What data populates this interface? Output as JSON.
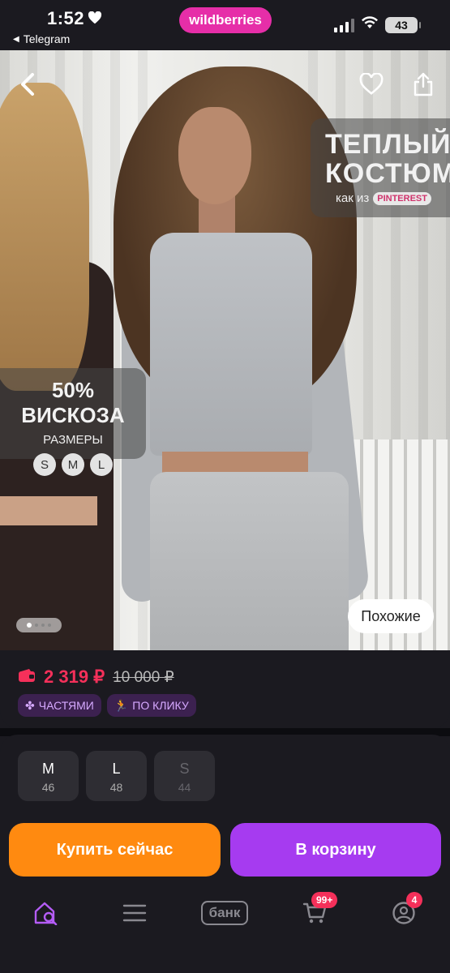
{
  "status_bar": {
    "time": "1:52",
    "back_app": "Telegram",
    "app_pill": "wildberries",
    "battery": "43"
  },
  "photo": {
    "badge_right": {
      "line1": "ТЕПЛЫЙ",
      "line2": "КОСТЮМ",
      "caption": "как из",
      "tag": "PINTEREST"
    },
    "badge_left": {
      "headline": "50% ВИСКОЗА",
      "sub": "РАЗМЕРЫ",
      "sizes": [
        "S",
        "M",
        "L"
      ]
    },
    "carousel": {
      "count": 4,
      "active_index": 0
    },
    "similar_button": "Похожие"
  },
  "price": {
    "current": "2 319 ₽",
    "old": "10 000 ₽",
    "chips": [
      "ЧАСТЯМИ",
      "ПО КЛИКУ"
    ]
  },
  "sizes": [
    {
      "size": "M",
      "ru": "46",
      "available": true
    },
    {
      "size": "L",
      "ru": "48",
      "available": true
    },
    {
      "size": "S",
      "ru": "44",
      "available": false
    }
  ],
  "actions": {
    "buy_now": "Купить сейчас",
    "add_to_cart": "В корзину"
  },
  "tabbar": {
    "bank_label": "банк",
    "cart_count": "99+",
    "profile_count": "4"
  },
  "colors": {
    "brand_pink": "#e62ea8",
    "price_red": "#f5305a",
    "buy_orange": "#ff8a10",
    "cart_purple": "#a63bf0"
  }
}
